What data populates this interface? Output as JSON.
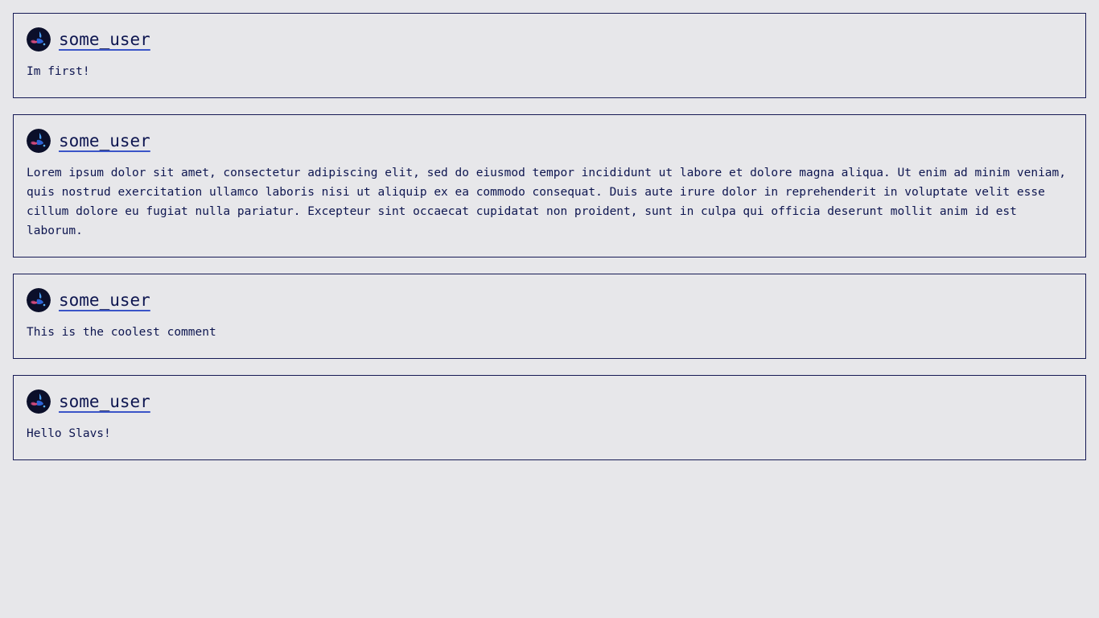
{
  "comments": [
    {
      "username": "some_user",
      "text": "Im first!"
    },
    {
      "username": "some_user",
      "text": "Lorem ipsum dolor sit amet, consectetur adipiscing elit, sed do eiusmod tempor incididunt ut labore et dolore magna aliqua. Ut enim ad minim veniam, quis nostrud exercitation ullamco laboris nisi ut aliquip ex ea commodo consequat. Duis aute irure dolor in reprehenderit in voluptate velit esse cillum dolore eu fugiat nulla pariatur. Excepteur sint occaecat cupidatat non proident, sunt in culpa qui officia deserunt mollit anim id est laborum."
    },
    {
      "username": "some_user",
      "text": "This is the coolest comment"
    },
    {
      "username": "some_user",
      "text": "Hello Slavs!"
    }
  ],
  "colors": {
    "background": "#e7e7ea",
    "border": "#161a55",
    "text": "#0e1650",
    "link_underline": "#3a55c8"
  },
  "icons": {
    "avatar": "user-avatar-icon"
  }
}
